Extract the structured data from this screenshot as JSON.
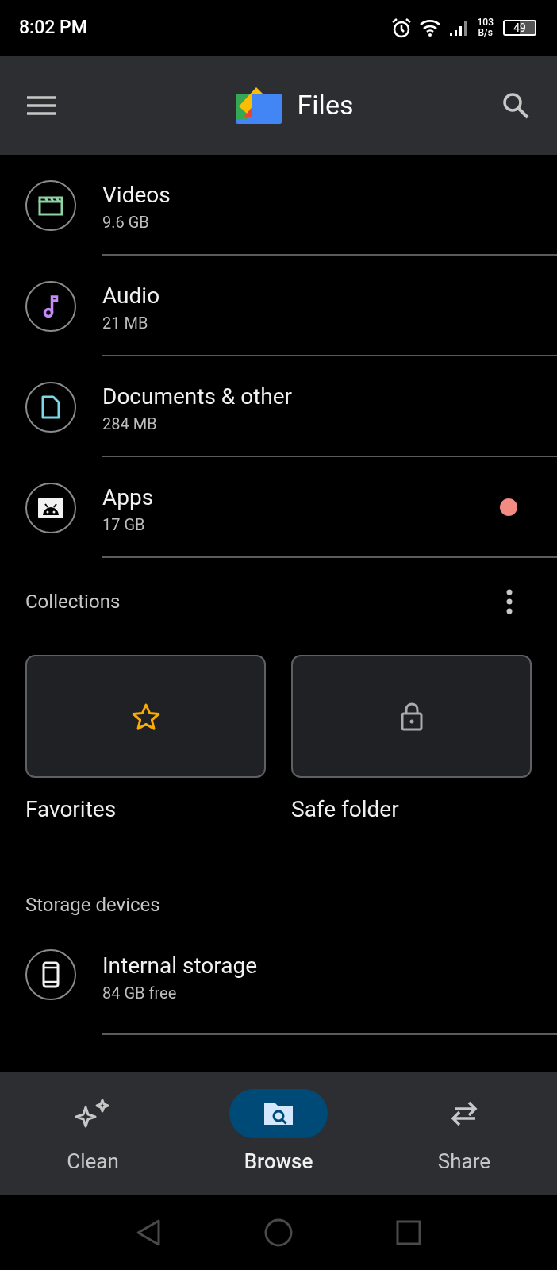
{
  "status_bar": {
    "time": "8:02 PM",
    "speed_value": "103",
    "speed_unit": "B/s",
    "battery": "49"
  },
  "app_bar": {
    "title": "Files"
  },
  "categories": [
    {
      "name": "Videos",
      "size": "9.6 GB",
      "kind": "video",
      "dot": false
    },
    {
      "name": "Audio",
      "size": "21 MB",
      "kind": "audio",
      "dot": false
    },
    {
      "name": "Documents & other",
      "size": "284 MB",
      "kind": "document",
      "dot": false
    },
    {
      "name": "Apps",
      "size": "17 GB",
      "kind": "apps",
      "dot": true
    }
  ],
  "collections": {
    "title": "Collections",
    "items": [
      {
        "label": "Favorites",
        "kind": "favorites"
      },
      {
        "label": "Safe folder",
        "kind": "safe"
      }
    ]
  },
  "storage": {
    "title": "Storage devices",
    "devices": [
      {
        "name": "Internal storage",
        "detail": "84 GB free"
      }
    ]
  },
  "bottom_nav": [
    {
      "label": "Clean",
      "kind": "clean",
      "selected": false
    },
    {
      "label": "Browse",
      "kind": "browse",
      "selected": true
    },
    {
      "label": "Share",
      "kind": "share",
      "selected": false
    }
  ]
}
